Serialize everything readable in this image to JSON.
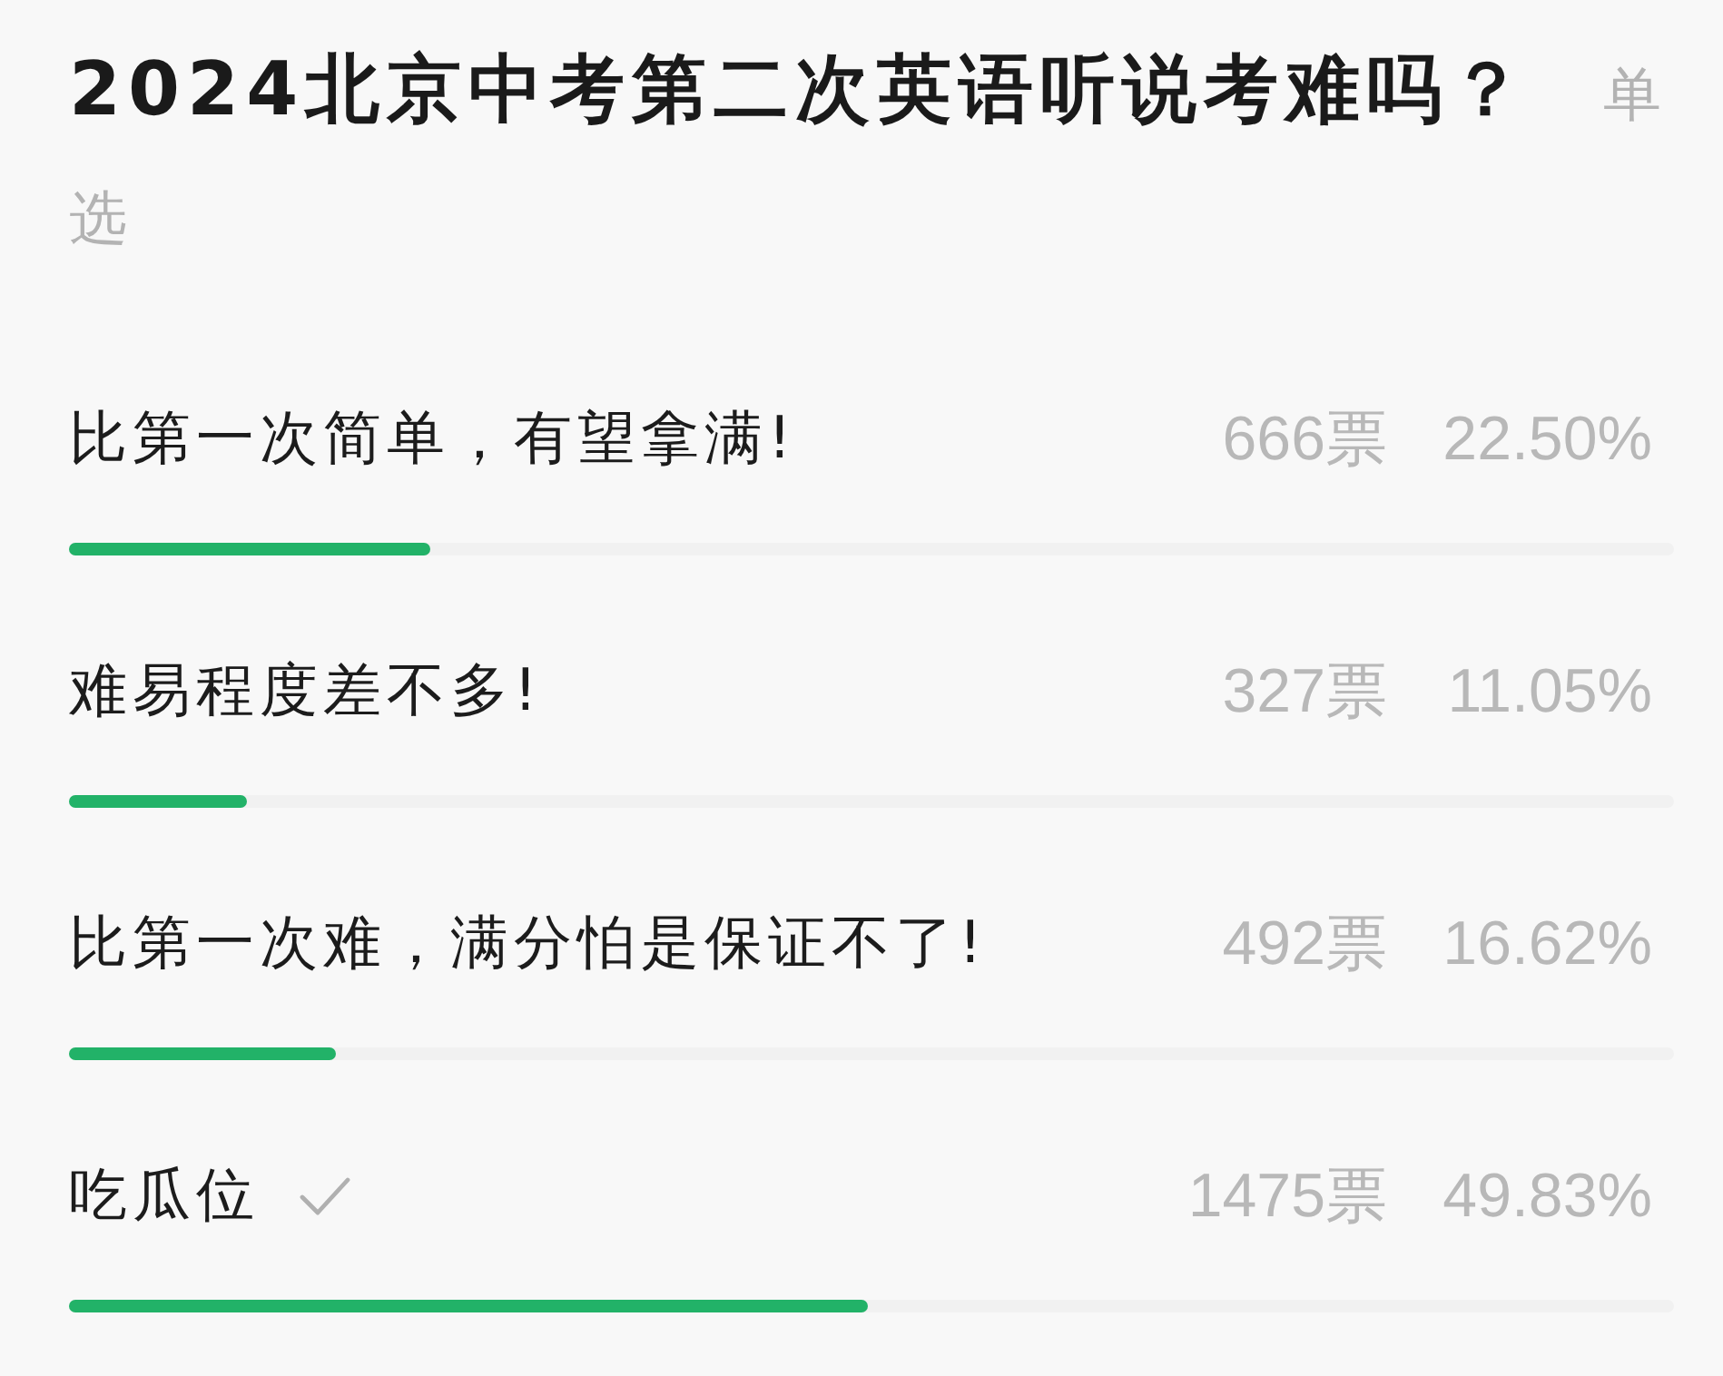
{
  "poll": {
    "title": "2024北京中考第二次英语听说考难吗？",
    "type_label": "单选"
  },
  "options": [
    {
      "text": "比第一次简单，有望拿满!",
      "votes": "666票",
      "percent": "22.50%",
      "level": 0.225,
      "selected": false
    },
    {
      "text": "难易程度差不多!",
      "votes": "327票",
      "percent": "11.05%",
      "level": 0.1105,
      "selected": false
    },
    {
      "text": "比第一次难，满分怕是保证不了!",
      "votes": "492票",
      "percent": "16.62%",
      "level": 0.1662,
      "selected": false
    },
    {
      "text": "吃瓜位",
      "votes": "1475票",
      "percent": "49.83%",
      "level": 0.4983,
      "selected": true
    }
  ]
}
